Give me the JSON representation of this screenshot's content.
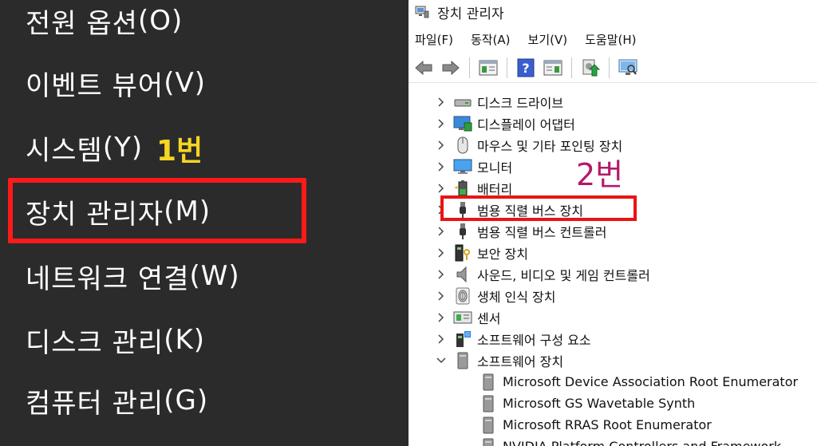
{
  "win_x_menu": {
    "items": [
      {
        "label": "전원 옵션",
        "accel": "(O)"
      },
      {
        "label": "이벤트 뷰어",
        "accel": "(V)"
      },
      {
        "label": "시스템",
        "accel": "(Y)"
      },
      {
        "label": "장치 관리자",
        "accel": "(M)"
      },
      {
        "label": "네트워크 연결",
        "accel": "(W)"
      },
      {
        "label": "디스크 관리",
        "accel": "(K)"
      },
      {
        "label": "컴퓨터 관리",
        "accel": "(G)"
      }
    ],
    "annotation": "1번",
    "annotation_color": "#f5d622",
    "highlight_color": "#ff1a1a"
  },
  "device_manager": {
    "title": "장치 관리자",
    "menu": [
      "파일(F)",
      "동작(A)",
      "보기(V)",
      "도움말(H)"
    ],
    "annotation": "2번",
    "annotation_color": "#b5196a",
    "tree": [
      {
        "label": "디스크 드라이브",
        "icon": "disk-drive-icon",
        "expanded": false
      },
      {
        "label": "디스플레이 어댑터",
        "icon": "display-adapter-icon",
        "expanded": false
      },
      {
        "label": "마우스 및 기타 포인팅 장치",
        "icon": "mouse-icon",
        "expanded": false
      },
      {
        "label": "모니터",
        "icon": "monitor-icon",
        "expanded": false
      },
      {
        "label": "배터리",
        "icon": "battery-icon",
        "expanded": false
      },
      {
        "label": "범용 직렬 버스 장치",
        "icon": "usb-icon",
        "expanded": false
      },
      {
        "label": "범용 직렬 버스 컨트롤러",
        "icon": "usb-controller-icon",
        "expanded": false
      },
      {
        "label": "보안 장치",
        "icon": "security-icon",
        "expanded": false
      },
      {
        "label": "사운드, 비디오 및 게임 컨트롤러",
        "icon": "speaker-icon",
        "expanded": false
      },
      {
        "label": "생체 인식 장치",
        "icon": "fingerprint-icon",
        "expanded": false
      },
      {
        "label": "센서",
        "icon": "sensor-icon",
        "expanded": false
      },
      {
        "label": "소프트웨어 구성 요소",
        "icon": "software-component-icon",
        "expanded": false
      },
      {
        "label": "소프트웨어 장치",
        "icon": "software-device-icon",
        "expanded": true
      }
    ],
    "software_devices": [
      "Microsoft Device Association Root Enumerator",
      "Microsoft GS Wavetable Synth",
      "Microsoft RRAS Root Enumerator",
      "NVIDIA Platform Controllers and Framework"
    ]
  }
}
